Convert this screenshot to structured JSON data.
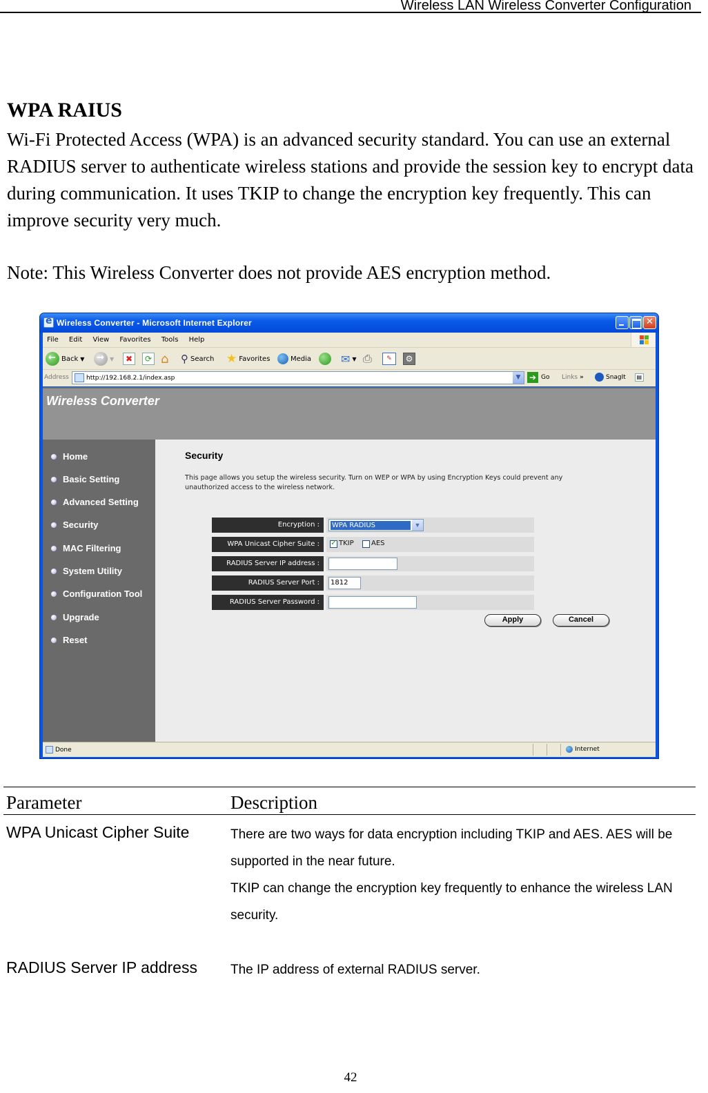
{
  "page": {
    "header": "Wireless LAN Wireless Converter Configuration",
    "section_title": "WPA RAIUS",
    "intro": "Wi-Fi Protected Access (WPA) is an advanced security standard. You can use an external RADIUS server to authenticate wireless stations and provide the session key to encrypt data during communication. It uses TKIP to change the encryption key frequently. This can improve security very much.",
    "note": "Note: This Wireless Converter does not provide AES encryption method.",
    "page_number": "42"
  },
  "browser": {
    "title": "Wireless Converter - Microsoft Internet Explorer",
    "menu": [
      "File",
      "Edit",
      "View",
      "Favorites",
      "Tools",
      "Help"
    ],
    "toolbar": {
      "back": "Back",
      "search": "Search",
      "favorites": "Favorites",
      "media": "Media"
    },
    "address_label": "Address",
    "url": "http://192.168.2.1/index.asp",
    "go": "Go",
    "links": "Links",
    "snagit": "SnagIt",
    "status": "Done",
    "zone": "Internet"
  },
  "app": {
    "brand": "Wireless Converter",
    "nav": [
      "Home",
      "Basic Setting",
      "Advanced Setting",
      "Security",
      "MAC Filtering",
      "System Utility",
      "Configuration Tool",
      "Upgrade",
      "Reset"
    ],
    "heading": "Security",
    "description": "This page allows you setup the wireless security. Turn on WEP or WPA by using Encryption Keys could prevent any unauthorized access to the wireless network.",
    "form": {
      "encryption_label": "Encryption :",
      "encryption_value": "WPA RADIUS",
      "cipher_label": "WPA Unicast Cipher Suite :",
      "tkip_label": "TKIP",
      "tkip_checked": true,
      "aes_label": "AES",
      "aes_checked": false,
      "ip_label": "RADIUS Server IP address :",
      "ip_value": "",
      "port_label": "RADIUS Server Port :",
      "port_value": "1812",
      "password_label": "RADIUS Server Password :",
      "password_value": ""
    },
    "apply": "Apply",
    "cancel": "Cancel"
  },
  "param_table": {
    "headers": [
      "Parameter",
      "Description"
    ],
    "rows": [
      {
        "name": "WPA Unicast Cipher Suite",
        "description": [
          "There are two ways for data encryption including TKIP and AES. AES will be supported in the near future.",
          "TKIP can change the encryption key frequently to enhance the wireless LAN security."
        ]
      },
      {
        "name": "RADIUS Server IP address",
        "description": [
          "The IP address of external RADIUS server."
        ]
      }
    ]
  }
}
